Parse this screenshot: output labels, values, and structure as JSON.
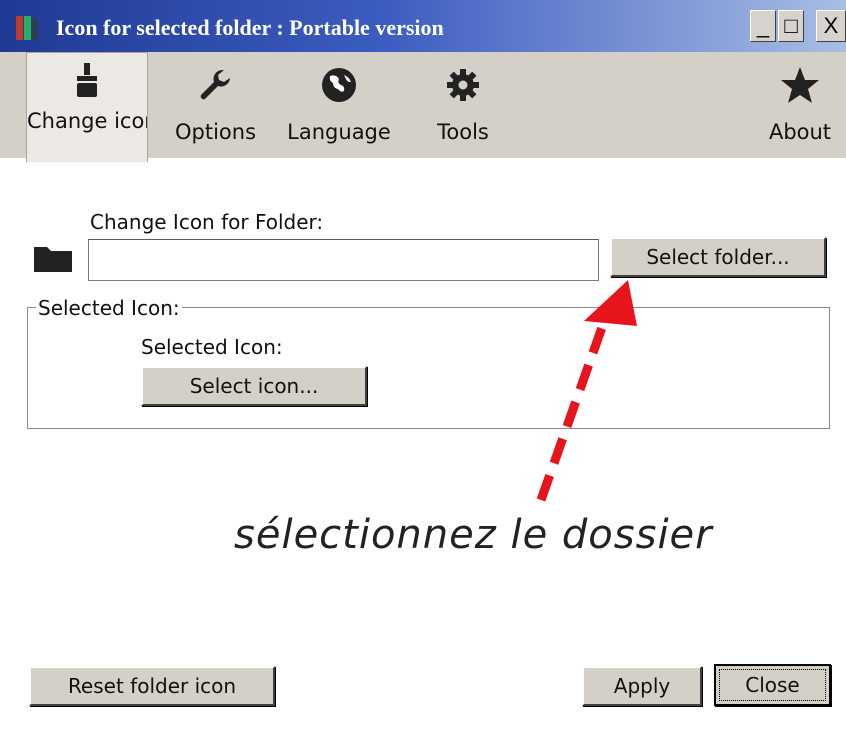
{
  "window": {
    "title": "Icon for selected folder : Portable version",
    "controls": {
      "minimize": "_",
      "maximize": "□",
      "close": "X"
    }
  },
  "toolbar": {
    "tabs": [
      {
        "label": "Change icon",
        "icon": "paint-brush-icon",
        "active": true
      },
      {
        "label": "Options",
        "icon": "wrench-icon",
        "active": false
      },
      {
        "label": "Language",
        "icon": "globe-icon",
        "active": false
      },
      {
        "label": "Tools",
        "icon": "gear-icon",
        "active": false
      },
      {
        "label": "About",
        "icon": "star-icon",
        "active": false
      }
    ]
  },
  "folder_section": {
    "label": "Change Icon for Folder:",
    "path_value": "",
    "select_button": "Select folder..."
  },
  "icon_section": {
    "group_title": "Selected Icon:",
    "label": "Selected Icon:",
    "select_button": "Select icon..."
  },
  "annotation": {
    "text": "sélectionnez le dossier",
    "arrow_color": "#e8141b"
  },
  "footer": {
    "reset_button": "Reset folder icon",
    "apply_button": "Apply",
    "close_button": "Close"
  }
}
